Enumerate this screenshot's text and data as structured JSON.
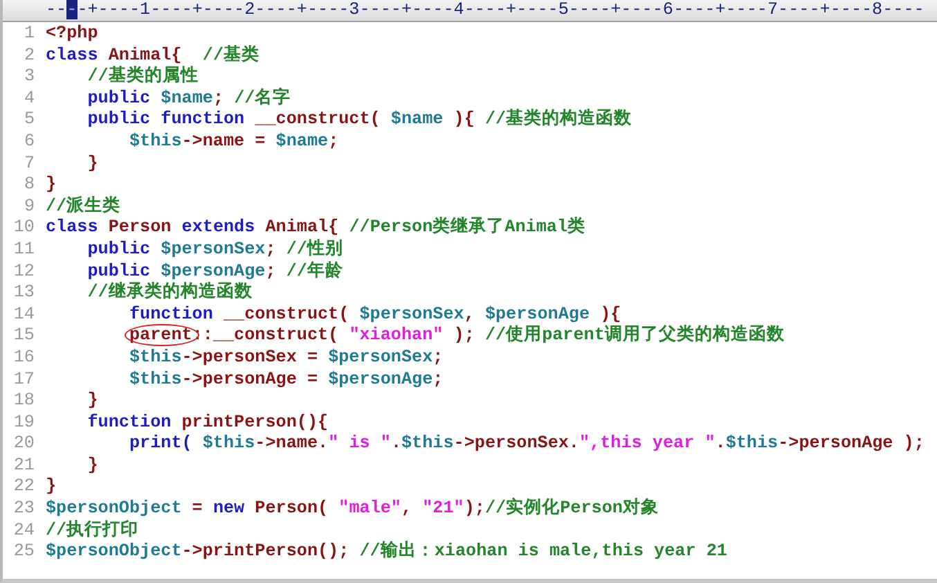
{
  "ruler": {
    "before": "--",
    "marker": "-",
    "after": "-+----1----+----2----+----3----+----4----+----5----+----6----+----7----+----8----"
  },
  "lines": [
    {
      "number": "1",
      "tokens": [
        {
          "kind": "ident",
          "text": "<?php"
        }
      ]
    },
    {
      "number": "2",
      "tokens": [
        {
          "kind": "keyword",
          "text": "class "
        },
        {
          "kind": "ident",
          "text": "Animal{  "
        },
        {
          "kind": "comment",
          "text": "//基类"
        }
      ]
    },
    {
      "number": "3",
      "tokens": [
        {
          "kind": "comment",
          "text": "    //基类的属性"
        }
      ]
    },
    {
      "number": "4",
      "tokens": [
        {
          "kind": "keyword",
          "text": "    public "
        },
        {
          "kind": "variable",
          "text": "$name"
        },
        {
          "kind": "ident",
          "text": "; "
        },
        {
          "kind": "comment",
          "text": "//名字"
        }
      ]
    },
    {
      "number": "5",
      "tokens": [
        {
          "kind": "keyword",
          "text": "    public function "
        },
        {
          "kind": "ident",
          "text": "__construct( "
        },
        {
          "kind": "variable",
          "text": "$name"
        },
        {
          "kind": "ident",
          "text": " ){ "
        },
        {
          "kind": "comment",
          "text": "//基类的构造函数"
        }
      ]
    },
    {
      "number": "6",
      "tokens": [
        {
          "kind": "variable",
          "text": "        $this"
        },
        {
          "kind": "ident",
          "text": "->name = "
        },
        {
          "kind": "variable",
          "text": "$name"
        },
        {
          "kind": "ident",
          "text": ";"
        }
      ]
    },
    {
      "number": "7",
      "tokens": [
        {
          "kind": "ident",
          "text": "    }"
        }
      ]
    },
    {
      "number": "8",
      "tokens": [
        {
          "kind": "ident",
          "text": "}"
        }
      ]
    },
    {
      "number": "9",
      "tokens": [
        {
          "kind": "comment",
          "text": "//派生类"
        }
      ]
    },
    {
      "number": "10",
      "tokens": [
        {
          "kind": "keyword",
          "text": "class "
        },
        {
          "kind": "ident",
          "text": "Person "
        },
        {
          "kind": "keyword",
          "text": "extends "
        },
        {
          "kind": "ident",
          "text": "Animal{ "
        },
        {
          "kind": "comment",
          "text": "//Person类继承了Animal类"
        }
      ]
    },
    {
      "number": "11",
      "tokens": [
        {
          "kind": "keyword",
          "text": "    public "
        },
        {
          "kind": "variable",
          "text": "$personSex"
        },
        {
          "kind": "ident",
          "text": "; "
        },
        {
          "kind": "comment",
          "text": "//性别"
        }
      ]
    },
    {
      "number": "12",
      "tokens": [
        {
          "kind": "keyword",
          "text": "    public "
        },
        {
          "kind": "variable",
          "text": "$personAge"
        },
        {
          "kind": "ident",
          "text": "; "
        },
        {
          "kind": "comment",
          "text": "//年龄"
        }
      ]
    },
    {
      "number": "13",
      "tokens": [
        {
          "kind": "comment",
          "text": "    //继承类的构造函数"
        }
      ]
    },
    {
      "number": "14",
      "tokens": [
        {
          "kind": "keyword",
          "text": "        function "
        },
        {
          "kind": "ident",
          "text": "__construct( "
        },
        {
          "kind": "variable",
          "text": "$personSex"
        },
        {
          "kind": "ident",
          "text": ", "
        },
        {
          "kind": "variable",
          "text": "$personAge"
        },
        {
          "kind": "ident",
          "text": " ){"
        }
      ]
    },
    {
      "number": "15",
      "tokens": [
        {
          "kind": "ident",
          "text": "        parent",
          "circled": true
        },
        {
          "kind": "ident",
          "text": "::__construct( "
        },
        {
          "kind": "string",
          "text": "\"xiaohan\""
        },
        {
          "kind": "ident",
          "text": " ); "
        },
        {
          "kind": "comment",
          "text": "//使用parent调用了父类的构造函数"
        }
      ]
    },
    {
      "number": "16",
      "tokens": [
        {
          "kind": "variable",
          "text": "        $this"
        },
        {
          "kind": "ident",
          "text": "->personSex = "
        },
        {
          "kind": "variable",
          "text": "$personSex"
        },
        {
          "kind": "ident",
          "text": ";"
        }
      ]
    },
    {
      "number": "17",
      "tokens": [
        {
          "kind": "variable",
          "text": "        $this"
        },
        {
          "kind": "ident",
          "text": "->personAge = "
        },
        {
          "kind": "variable",
          "text": "$personAge"
        },
        {
          "kind": "ident",
          "text": ";"
        }
      ]
    },
    {
      "number": "18",
      "tokens": [
        {
          "kind": "ident",
          "text": "    }"
        }
      ]
    },
    {
      "number": "19",
      "tokens": [
        {
          "kind": "keyword",
          "text": "    function "
        },
        {
          "kind": "ident",
          "text": "printPerson(){"
        }
      ]
    },
    {
      "number": "20",
      "tokens": [
        {
          "kind": "keyword",
          "text": "        print( "
        },
        {
          "kind": "variable",
          "text": "$this"
        },
        {
          "kind": "ident",
          "text": "->name."
        },
        {
          "kind": "string",
          "text": "\" is \""
        },
        {
          "kind": "ident",
          "text": "."
        },
        {
          "kind": "variable",
          "text": "$this"
        },
        {
          "kind": "ident",
          "text": "->personSex."
        },
        {
          "kind": "string",
          "text": "\",this year \""
        },
        {
          "kind": "ident",
          "text": "."
        },
        {
          "kind": "variable",
          "text": "$this"
        },
        {
          "kind": "ident",
          "text": "->personAge );"
        }
      ]
    },
    {
      "number": "21",
      "tokens": [
        {
          "kind": "ident",
          "text": "    }"
        }
      ]
    },
    {
      "number": "22",
      "tokens": [
        {
          "kind": "ident",
          "text": "}"
        }
      ]
    },
    {
      "number": "23",
      "tokens": [
        {
          "kind": "variable",
          "text": "$personObject"
        },
        {
          "kind": "ident",
          "text": " = "
        },
        {
          "kind": "keyword",
          "text": "new "
        },
        {
          "kind": "ident",
          "text": "Person( "
        },
        {
          "kind": "string",
          "text": "\"male\""
        },
        {
          "kind": "ident",
          "text": ", "
        },
        {
          "kind": "string",
          "text": "\"21\""
        },
        {
          "kind": "ident",
          "text": ");"
        },
        {
          "kind": "comment",
          "text": "//实例化Person对象"
        }
      ]
    },
    {
      "number": "24",
      "tokens": [
        {
          "kind": "comment",
          "text": "//执行打印"
        }
      ]
    },
    {
      "number": "25",
      "tokens": [
        {
          "kind": "variable",
          "text": "$personObject"
        },
        {
          "kind": "ident",
          "text": "->printPerson(); "
        },
        {
          "kind": "comment",
          "text": "//输出：xiaohan is male,this year 21"
        }
      ]
    }
  ]
}
